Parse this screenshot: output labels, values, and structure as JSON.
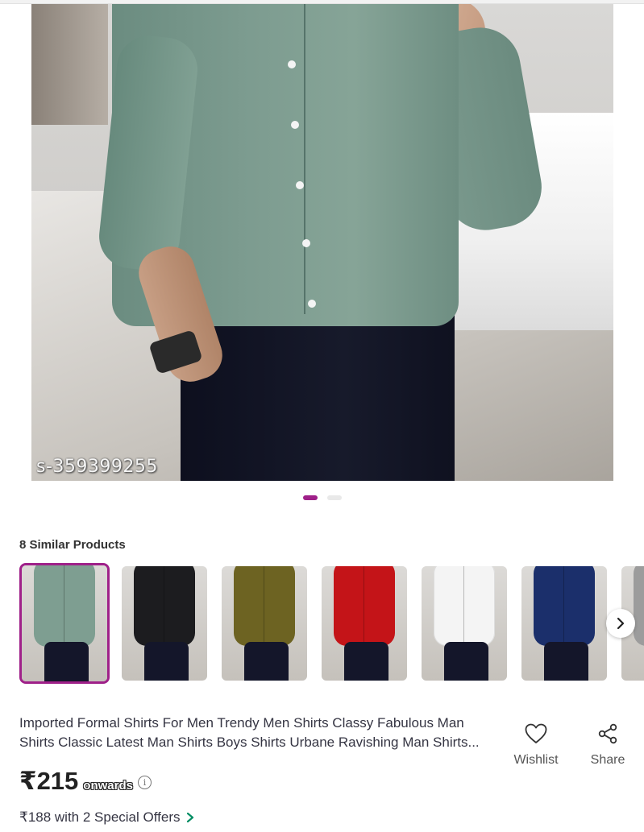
{
  "product": {
    "sku_watermark": "s-359399255",
    "title": "Imported Formal Shirts For Men Trendy Men Shirts Classy Fabulous Man Shirts Classic Latest Man Shirts Boys Shirts  Urbane Ravishing Man Shirts...",
    "price": "₹215",
    "price_suffix": "onwards",
    "offer_text": "₹188 with 2 Special Offers",
    "image_count": 2,
    "active_image_index": 0
  },
  "similar": {
    "title": "8 Similar Products",
    "visible_colors": [
      "#7e9e91",
      "#1c1c1f",
      "#6d6322",
      "#c41418",
      "#f4f4f4",
      "#1b2f6b",
      "#9c9c9c"
    ],
    "selected_index": 0
  },
  "actions": {
    "wishlist_label": "Wishlist",
    "share_label": "Share"
  },
  "colors": {
    "accent": "#9f2089",
    "text": "#353543"
  }
}
